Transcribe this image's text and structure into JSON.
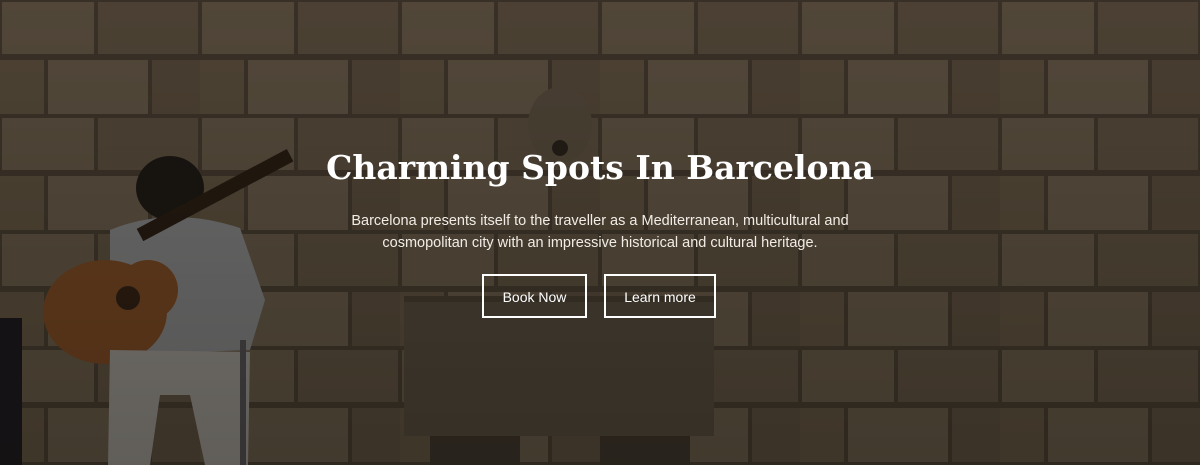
{
  "hero": {
    "title": "Charming Spots In Barcelona",
    "subtitle_line1": "Barcelona presents itself to the traveller as a Mediterranean, multicultural and",
    "subtitle_line2": "cosmopolitan city with an impressive historical and cultural heritage.",
    "primary_button_label": "Book Now",
    "secondary_button_label": "Learn more"
  },
  "colors": {
    "text": "#ffffff",
    "overlay": "rgba(20,16,10,0.45)",
    "stone": "#7d6d58"
  },
  "background_image": "stone-wall-guitarist-photo"
}
